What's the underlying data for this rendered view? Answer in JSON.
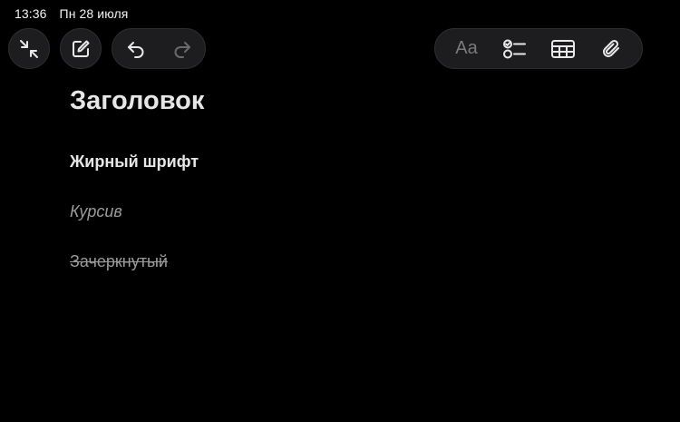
{
  "status_bar": {
    "time": "13:36",
    "date": "Пн 28 июля"
  },
  "toolbar": {
    "collapse_icon": "collapse-arrows-icon",
    "compose_icon": "compose-icon",
    "undo_icon": "undo-icon",
    "redo_icon": "redo-icon",
    "format_label": "Aa",
    "checklist_icon": "checklist-icon",
    "table_icon": "table-icon",
    "attachment_icon": "paperclip-icon"
  },
  "note": {
    "title": "Заголовок",
    "lines": [
      {
        "style": "bold",
        "text": "Жирный шрифт"
      },
      {
        "style": "italic",
        "text": "Курсив"
      },
      {
        "style": "strikethrough",
        "text": "Зачеркнутый"
      }
    ]
  },
  "colors": {
    "background": "#000000",
    "pill_background": "#1d1d1f",
    "icon_active": "#e8e8e8",
    "icon_disabled": "#6a6a6c",
    "text_primary": "#e6e6e6",
    "text_secondary": "#9a9a9c"
  }
}
